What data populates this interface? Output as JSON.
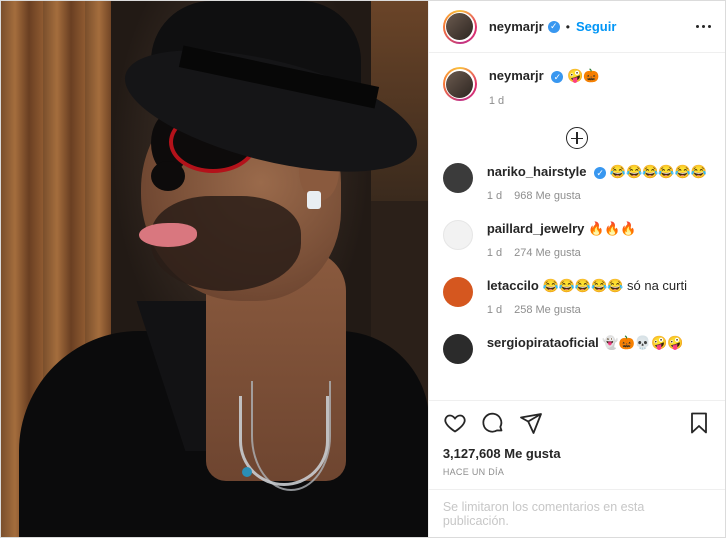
{
  "post_author": {
    "username": "neymarjr",
    "follow_label": "Seguir",
    "separator": "•"
  },
  "caption": {
    "username": "neymarjr",
    "text": "🤪🎃",
    "time": "1 d"
  },
  "comments": [
    {
      "username": "nariko_hairstyle",
      "verified": true,
      "text": "😂😂😂😂😂😂",
      "time": "1 d",
      "likes": "968 Me gusta",
      "avatar_color": "#3b3b3b"
    },
    {
      "username": "paillard_jewelry",
      "verified": false,
      "text": "🔥🔥🔥",
      "time": "1 d",
      "likes": "274 Me gusta",
      "avatar_color": "#f2f2f2"
    },
    {
      "username": "letaccilo",
      "verified": false,
      "text": "😂😂😂😂😂 só na curti",
      "time": "1 d",
      "likes": "258 Me gusta",
      "avatar_color": "#d5571f"
    },
    {
      "username": "sergiopirataoficial",
      "verified": false,
      "text": "👻🎃💀🤪🤪",
      "time": "",
      "likes": "",
      "avatar_color": "#2b2b2b"
    }
  ],
  "stats": {
    "likes": "3,127,608 Me gusta",
    "timestamp": "HACE UN DÍA"
  },
  "comments_limited": "Se limitaron los comentarios en esta publicación.",
  "colors": {
    "accent": "#0095f6",
    "verified": "#3897f0",
    "muted": "#8e8e8e"
  }
}
